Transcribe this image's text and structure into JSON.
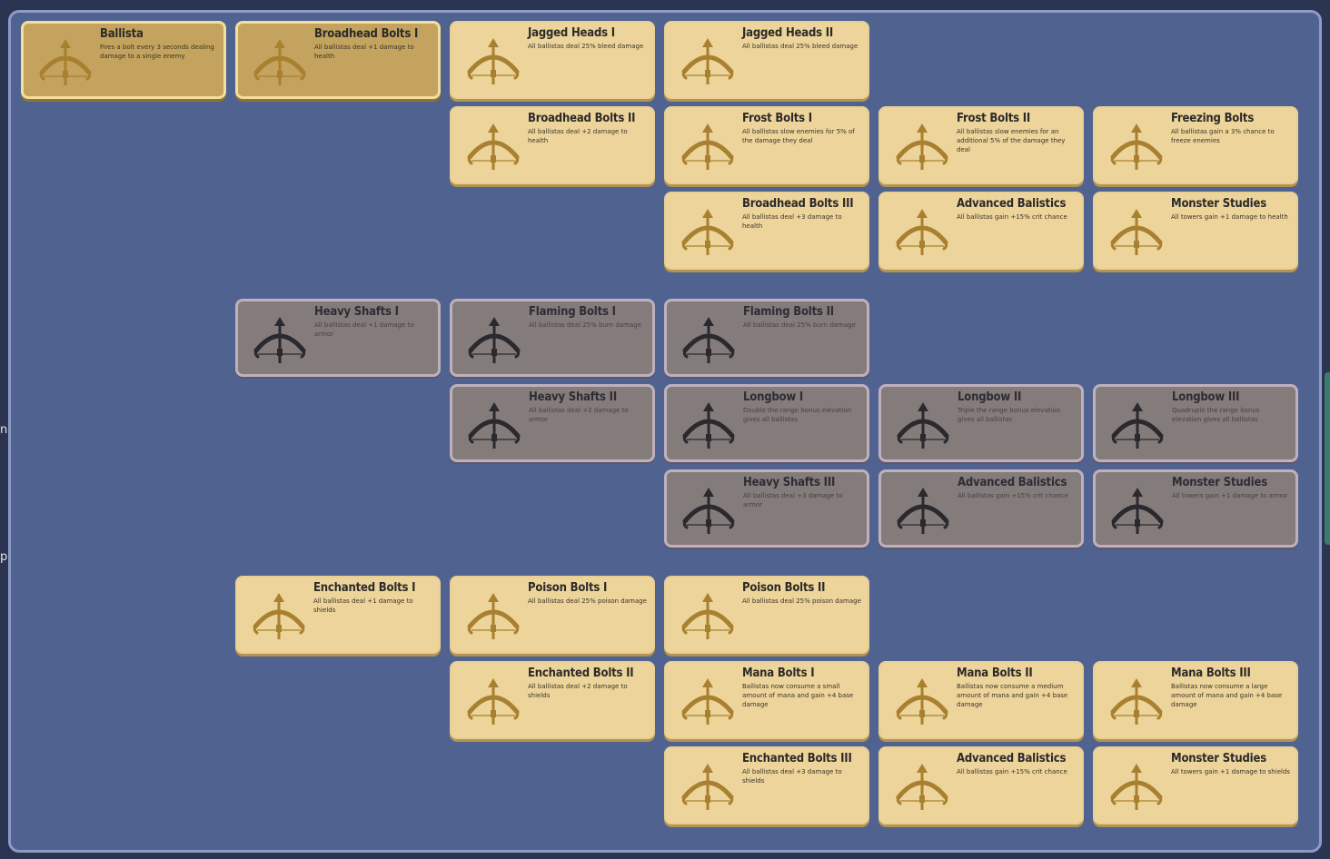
{
  "edge_glyphs": [
    "n)",
    "p"
  ],
  "colors": {
    "panel": "#4f6290",
    "available": "#ecd49b",
    "purchased": "#c3a35e",
    "locked": "#847b7b",
    "icon_gold": "#a8802f",
    "icon_dark": "#2a2a2e"
  },
  "nodes": [
    {
      "title": "Ballista",
      "desc": "Fires a bolt every 3 seconds dealing damage to a single enemy",
      "state": "purchased",
      "icon": "crossbow-icon",
      "col": 0,
      "row": 0
    },
    {
      "title": "Broadhead Bolts I",
      "desc": "All ballistas deal +1 damage to health",
      "state": "purchased",
      "icon": "crossbow-icon",
      "col": 1,
      "row": 0
    },
    {
      "title": "Jagged Heads I",
      "desc": "All ballistas deal 25% bleed damage",
      "state": "available",
      "icon": "crossbow-icon",
      "col": 2,
      "row": 0
    },
    {
      "title": "Jagged Heads II",
      "desc": "All ballistas deal 25% bleed damage",
      "state": "available",
      "icon": "crossbow-icon",
      "col": 3,
      "row": 0
    },
    {
      "title": "Broadhead Bolts II",
      "desc": "All ballistas deal +2 damage to health",
      "state": "available",
      "icon": "crossbow-icon",
      "col": 2,
      "row": 1
    },
    {
      "title": "Frost Bolts I",
      "desc": "All ballistas slow enemies for 5% of the damage they deal",
      "state": "available",
      "icon": "crossbow-icon",
      "col": 3,
      "row": 1
    },
    {
      "title": "Frost Bolts II",
      "desc": "All ballistas slow enemies for an additional 5% of the damage they deal",
      "state": "available",
      "icon": "crossbow-icon",
      "col": 4,
      "row": 1
    },
    {
      "title": "Freezing Bolts",
      "desc": "All ballistas gain a 3% chance to freeze enemies",
      "state": "available",
      "icon": "crossbow-icon",
      "col": 5,
      "row": 1
    },
    {
      "title": "Broadhead Bolts III",
      "desc": "All ballistas deal +3 damage to health",
      "state": "available",
      "icon": "crossbow-icon",
      "col": 3,
      "row": 2
    },
    {
      "title": "Advanced Balistics",
      "desc": "All ballistas gain +15% crit chance",
      "state": "available",
      "icon": "crossbow-icon",
      "col": 4,
      "row": 2
    },
    {
      "title": "Monster Studies",
      "desc": "All towers gain +1 damage to health",
      "state": "available",
      "icon": "crossbow-icon",
      "col": 5,
      "row": 2
    },
    {
      "title": "Heavy Shafts I",
      "desc": "All ballistas deal +1 damage to armor",
      "state": "locked",
      "icon": "crossbow-icon",
      "col": 1,
      "row": 3
    },
    {
      "title": "Flaming Bolts I",
      "desc": "All ballistas deal 25% burn damage",
      "state": "locked",
      "icon": "crossbow-icon",
      "col": 2,
      "row": 3
    },
    {
      "title": "Flaming Bolts II",
      "desc": "All ballistas deal 25% burn damage",
      "state": "locked",
      "icon": "crossbow-icon",
      "col": 3,
      "row": 3
    },
    {
      "title": "Heavy Shafts II",
      "desc": "All ballistas deal +2 damage to armor",
      "state": "locked",
      "icon": "crossbow-icon",
      "col": 2,
      "row": 4
    },
    {
      "title": "Longbow I",
      "desc": "Double the range bonus elevation gives all ballistas",
      "state": "locked",
      "icon": "crossbow-icon",
      "col": 3,
      "row": 4
    },
    {
      "title": "Longbow II",
      "desc": "Triple the range bonus elevation gives all ballistas",
      "state": "locked",
      "icon": "crossbow-icon",
      "col": 4,
      "row": 4
    },
    {
      "title": "Longbow III",
      "desc": "Quadruple the range bonus elevation gives all ballistas",
      "state": "locked",
      "icon": "crossbow-icon",
      "col": 5,
      "row": 4
    },
    {
      "title": "Heavy Shafts III",
      "desc": "All ballistas deal +3 damage to armor",
      "state": "locked",
      "icon": "crossbow-icon",
      "col": 3,
      "row": 5
    },
    {
      "title": "Advanced Balistics",
      "desc": "All ballistas gain +15% crit chance",
      "state": "locked",
      "icon": "crossbow-icon",
      "col": 4,
      "row": 5
    },
    {
      "title": "Monster Studies",
      "desc": "All towers gain +1 damage to armor",
      "state": "locked",
      "icon": "crossbow-icon",
      "col": 5,
      "row": 5
    },
    {
      "title": "Enchanted Bolts I",
      "desc": "All ballistas deal +1 damage to shields",
      "state": "available",
      "icon": "crossbow-icon",
      "col": 1,
      "row": 6
    },
    {
      "title": "Poison Bolts I",
      "desc": "All ballistas deal 25% poison damage",
      "state": "available",
      "icon": "crossbow-icon",
      "col": 2,
      "row": 6
    },
    {
      "title": "Poison Bolts II",
      "desc": "All ballistas deal 25% poison damage",
      "state": "available",
      "icon": "crossbow-icon",
      "col": 3,
      "row": 6
    },
    {
      "title": "Enchanted Bolts II",
      "desc": "All ballistas deal +2 damage to shields",
      "state": "available",
      "icon": "crossbow-icon",
      "col": 2,
      "row": 7
    },
    {
      "title": "Mana Bolts I",
      "desc": "Ballistas now consume a small amount of mana and gain +4 base damage",
      "state": "available",
      "icon": "crossbow-icon",
      "col": 3,
      "row": 7
    },
    {
      "title": "Mana Bolts II",
      "desc": "Ballistas now consume a medium amount of mana and gain +4 base damage",
      "state": "available",
      "icon": "crossbow-icon",
      "col": 4,
      "row": 7
    },
    {
      "title": "Mana Bolts III",
      "desc": "Ballistas now consume a large amount of mana and gain +4 base damage",
      "state": "available",
      "icon": "crossbow-icon",
      "col": 5,
      "row": 7
    },
    {
      "title": "Enchanted Bolts III",
      "desc": "All ballistas deal +3 damage to shields",
      "state": "available",
      "icon": "crossbow-icon",
      "col": 3,
      "row": 8
    },
    {
      "title": "Advanced Balistics",
      "desc": "All ballistas gain +15% crit chance",
      "state": "available",
      "icon": "crossbow-icon",
      "col": 4,
      "row": 8
    },
    {
      "title": "Monster Studies",
      "desc": "All towers gain +1 damage to shields",
      "state": "available",
      "icon": "crossbow-icon",
      "col": 5,
      "row": 8
    }
  ]
}
